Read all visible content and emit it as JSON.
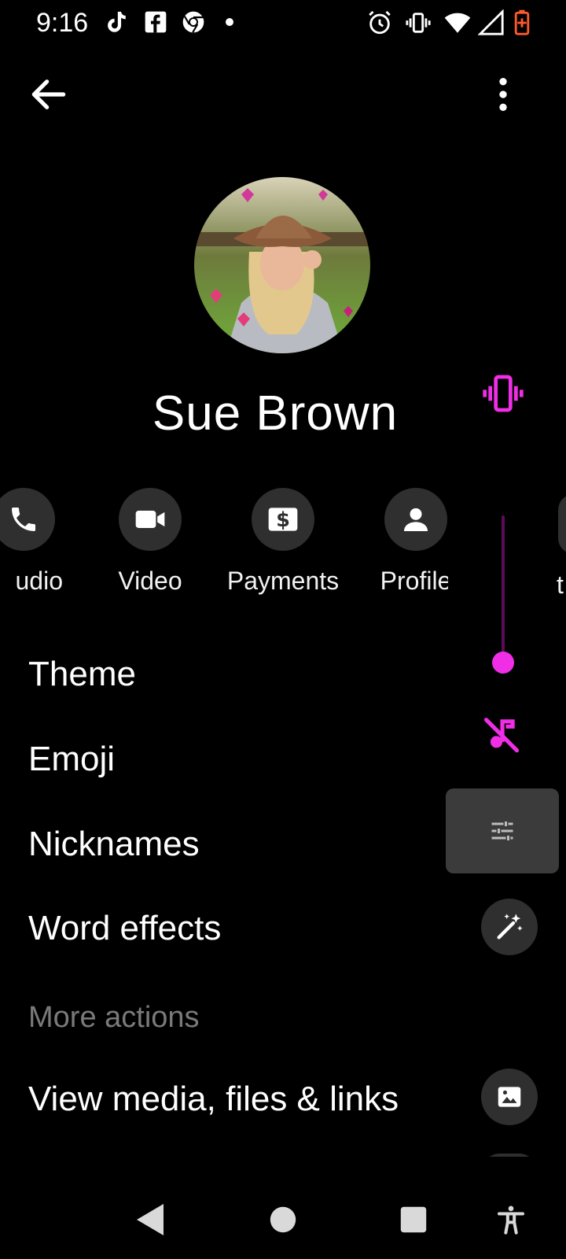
{
  "status_bar": {
    "time": "9:16",
    "left_icons": [
      "tiktok-icon",
      "facebook-icon",
      "chrome-icon",
      "dot-icon"
    ],
    "right_icons": [
      "alarm-icon",
      "vibrate-icon",
      "wifi-icon",
      "signal-icon",
      "battery-icon"
    ],
    "battery_color": "#ff5a2e"
  },
  "app_bar": {
    "back_icon": "arrow-left-icon",
    "menu_icon": "more-vert-icon"
  },
  "profile": {
    "name": "Sue Brown"
  },
  "actions": [
    {
      "label": "udio",
      "icon": "phone-icon"
    },
    {
      "label": "Video",
      "icon": "video-icon"
    },
    {
      "label": "Payments",
      "icon": "payment-icon"
    },
    {
      "label": "Profile",
      "icon": "person-icon"
    },
    {
      "label": "t",
      "icon": "partial-icon"
    }
  ],
  "list": [
    {
      "label": "Theme"
    },
    {
      "label": "Emoji"
    },
    {
      "label": "Nicknames"
    },
    {
      "label": "Word effects",
      "icon": "magic-wand-icon"
    }
  ],
  "more_actions": {
    "header": "More actions",
    "items": [
      {
        "label": "View media, files & links",
        "icon": "image-icon"
      }
    ]
  },
  "volume_panel": {
    "accent_color": "#ef2ee6",
    "level": 0.1,
    "icons": [
      "vibrate-mode-icon",
      "music-off-icon",
      "tune-icon"
    ]
  },
  "nav_bar": {
    "icons": [
      "back-triangle-icon",
      "home-circle-icon",
      "recents-square-icon",
      "accessibility-icon"
    ]
  }
}
